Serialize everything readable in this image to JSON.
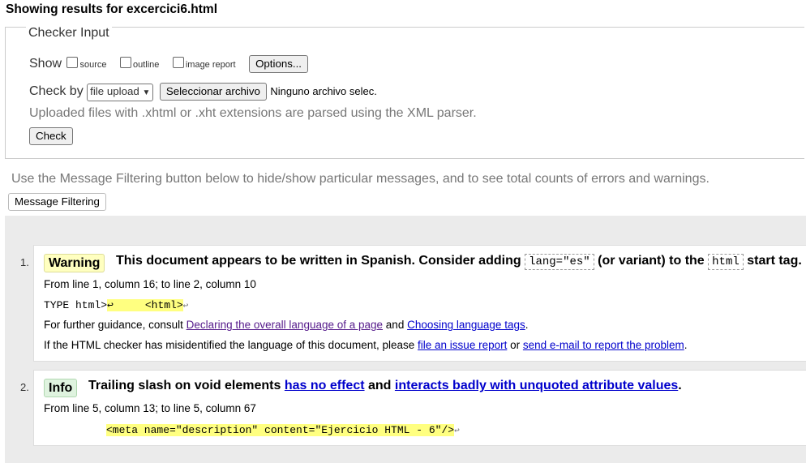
{
  "header": {
    "title": "Showing results for excercici6.html"
  },
  "checker": {
    "legend": "Checker Input",
    "show_label": "Show",
    "options": [
      {
        "label": "source",
        "checked": false
      },
      {
        "label": "outline",
        "checked": false
      },
      {
        "label": "image report",
        "checked": false
      }
    ],
    "options_button": "Options...",
    "check_by_label": "Check by",
    "check_by_value": "file upload",
    "choose_file_button": "Seleccionar archivo",
    "no_file_text": "Ninguno archivo selec.",
    "parser_note": "Uploaded files with .xhtml or .xht extensions are parsed using the XML parser.",
    "check_button": "Check"
  },
  "filtering": {
    "info": "Use the Message Filtering button below to hide/show particular messages, and to see total counts of errors and warnings.",
    "button": "Message Filtering"
  },
  "messages": [
    {
      "number": "1.",
      "type": "Warning",
      "text_a": "This document appears to be written in Spanish. Consider adding",
      "code_a": "lang=\"es\"",
      "text_b": "(or variant) to the",
      "code_b": "html",
      "text_c": "start tag.",
      "location": "From line 1, column 16; to line 2, column 10",
      "extract_pre": "TYPE html>",
      "extract_mid": "↩     <html>",
      "extract_post": "↩",
      "guidance_pre": "For further guidance, consult",
      "guidance_link1": "Declaring the overall language of a page",
      "guidance_and": "and",
      "guidance_link2": "Choosing language tags",
      "guidance_end": ".",
      "misid_pre": "If the HTML checker has misidentified the language of this document, please",
      "misid_link1": "file an issue report",
      "misid_or": "or",
      "misid_link2": "send e-mail to report the problem",
      "misid_end": "."
    },
    {
      "number": "2.",
      "type": "Info",
      "text_a": "Trailing slash on void elements",
      "link_a": "has no effect",
      "text_and": "and",
      "link_b": "interacts badly with unquoted attribute values",
      "text_end": ".",
      "location": "From line 5, column 13; to line 5, column 67",
      "extract": "<meta name=\"description\" content=\"Ejercicio HTML - 6\"/>",
      "extract_post": "↩"
    }
  ]
}
